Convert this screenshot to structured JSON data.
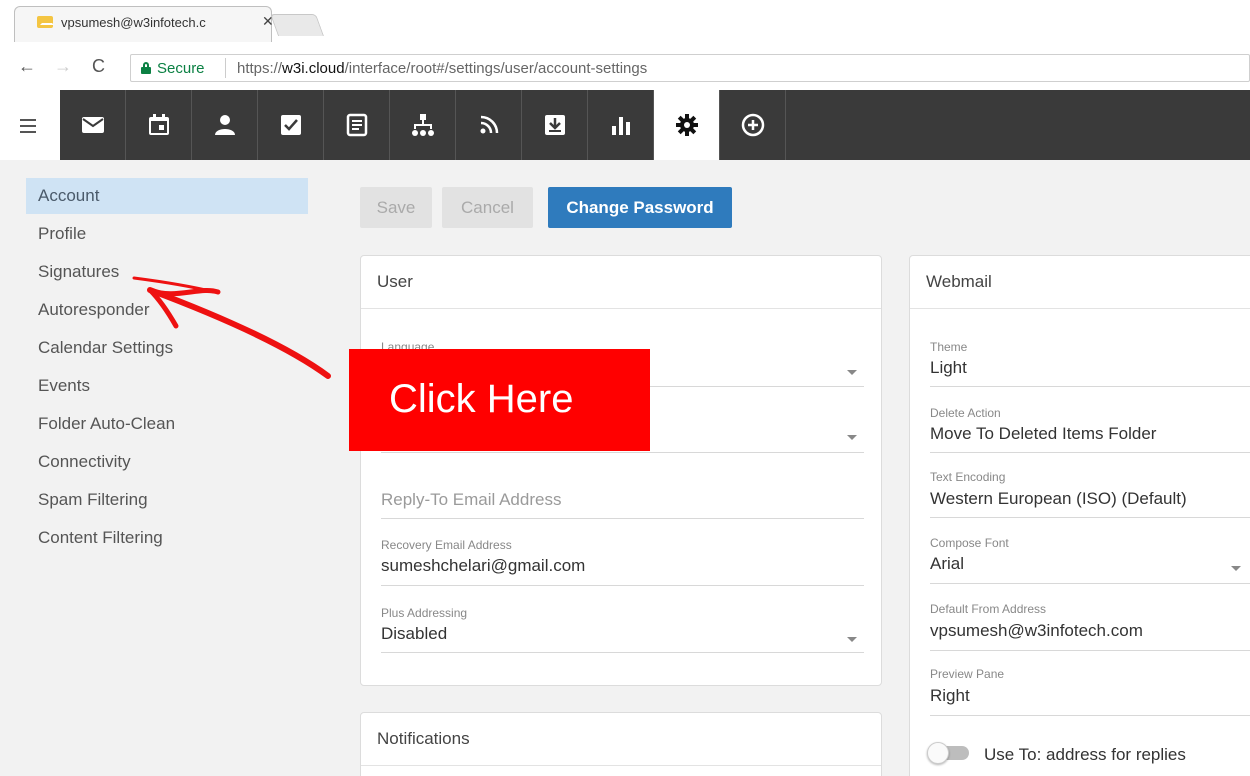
{
  "browser": {
    "tab_title": "vpsumesh@w3infotech.c",
    "tab_close": "✕",
    "secure_label": "Secure",
    "url_scheme": "https://",
    "url_host": "w3i.cloud",
    "url_path": "/interface/root#/settings/user/account-settings"
  },
  "toolbar": {
    "items": [
      "mail-icon",
      "calendar-icon",
      "contacts-icon",
      "tasks-icon",
      "notes-icon",
      "sitemap-icon",
      "rss-icon",
      "download-icon",
      "chart-icon",
      "settings-icon",
      "add-icon"
    ],
    "active": "settings-icon"
  },
  "sidebar": {
    "items": [
      {
        "label": "Account",
        "active": true
      },
      {
        "label": "Profile"
      },
      {
        "label": "Signatures"
      },
      {
        "label": "Autoresponder"
      },
      {
        "label": "Calendar Settings"
      },
      {
        "label": "Events"
      },
      {
        "label": "Folder Auto-Clean"
      },
      {
        "label": "Connectivity"
      },
      {
        "label": "Spam Filtering"
      },
      {
        "label": "Content Filtering"
      }
    ]
  },
  "actions": {
    "save": "Save",
    "cancel": "Cancel",
    "change_password": "Change Password"
  },
  "user_card": {
    "title": "User",
    "language_label": "Language",
    "reply_to_placeholder": "Reply-To Email Address",
    "recovery_label": "Recovery Email Address",
    "recovery_value": "sumeshchelari@gmail.com",
    "plus_label": "Plus Addressing",
    "plus_value": "Disabled"
  },
  "webmail_card": {
    "title": "Webmail",
    "theme_label": "Theme",
    "theme_value": "Light",
    "delete_label": "Delete Action",
    "delete_value": "Move To Deleted Items Folder",
    "encoding_label": "Text Encoding",
    "encoding_value": "Western European (ISO) (Default)",
    "font_label": "Compose Font",
    "font_value": "Arial",
    "from_label": "Default From Address",
    "from_value": "vpsumesh@w3infotech.com",
    "preview_label": "Preview Pane",
    "preview_value": "Right",
    "replies_toggle_label": "Use To: address for replies",
    "replies_toggle_on": false
  },
  "notifications_card": {
    "title": "Notifications"
  },
  "annotation": {
    "callout_text": "Click Here",
    "color": "#ff0000"
  },
  "colors": {
    "toolbar_bg": "#3a3a3a",
    "primary_button": "#2f7bbd",
    "sidebar_active": "#cfe3f4",
    "secure_green": "#0b8043"
  }
}
